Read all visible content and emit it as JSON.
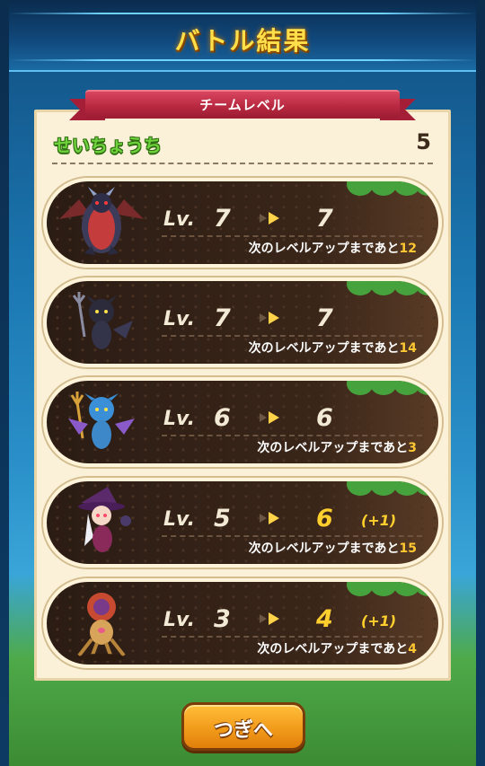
{
  "header": {
    "title": "バトル結果"
  },
  "team": {
    "ribbon_label": "チームレベル",
    "name": "せいちょうち",
    "level": "5"
  },
  "lv_prefix": "Lv.",
  "next_prefix": "次のレベルアップまであと",
  "members": [
    {
      "icon": "dragon-monster-icon",
      "from": "7",
      "to": "7",
      "bonus": "",
      "remaining": "12"
    },
    {
      "icon": "dark-imp-monster-icon",
      "from": "7",
      "to": "7",
      "bonus": "",
      "remaining": "14"
    },
    {
      "icon": "blue-imp-monster-icon",
      "from": "6",
      "to": "6",
      "bonus": "",
      "remaining": "3"
    },
    {
      "icon": "witch-monster-icon",
      "from": "5",
      "to": "6",
      "bonus": "(+1)",
      "remaining": "15"
    },
    {
      "icon": "flower-monster-icon",
      "from": "3",
      "to": "4",
      "bonus": "(+1)",
      "remaining": "4"
    }
  ],
  "next_button": "つぎへ",
  "colors": {
    "title": "#ffe04a",
    "levelup": "#ffcf2e",
    "ribbon": "#b82940",
    "button": "#f29b1b"
  }
}
